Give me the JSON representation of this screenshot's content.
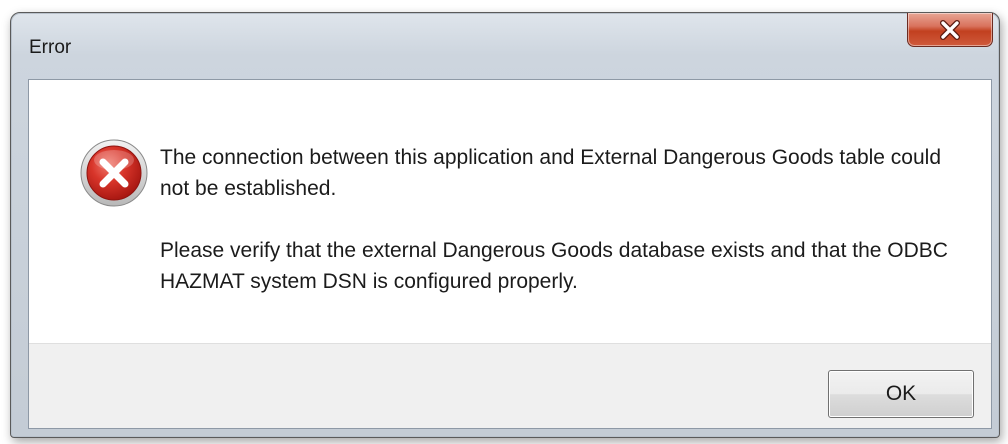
{
  "window": {
    "title": "Error"
  },
  "title_bar": {
    "close_button_icon": "close-x-icon"
  },
  "message": {
    "icon": "error-icon",
    "line1": "The connection between this application and External Dangerous Goods table could not be established.",
    "line2": "Please verify that the external Dangerous Goods database exists and that the ODBC HAZMAT system DSN is configured properly."
  },
  "buttons": {
    "ok_label": "OK"
  },
  "colors": {
    "error_red": "#c8231d",
    "close_button_red": "#c2401f",
    "footer_gray": "#f0f0f0"
  }
}
